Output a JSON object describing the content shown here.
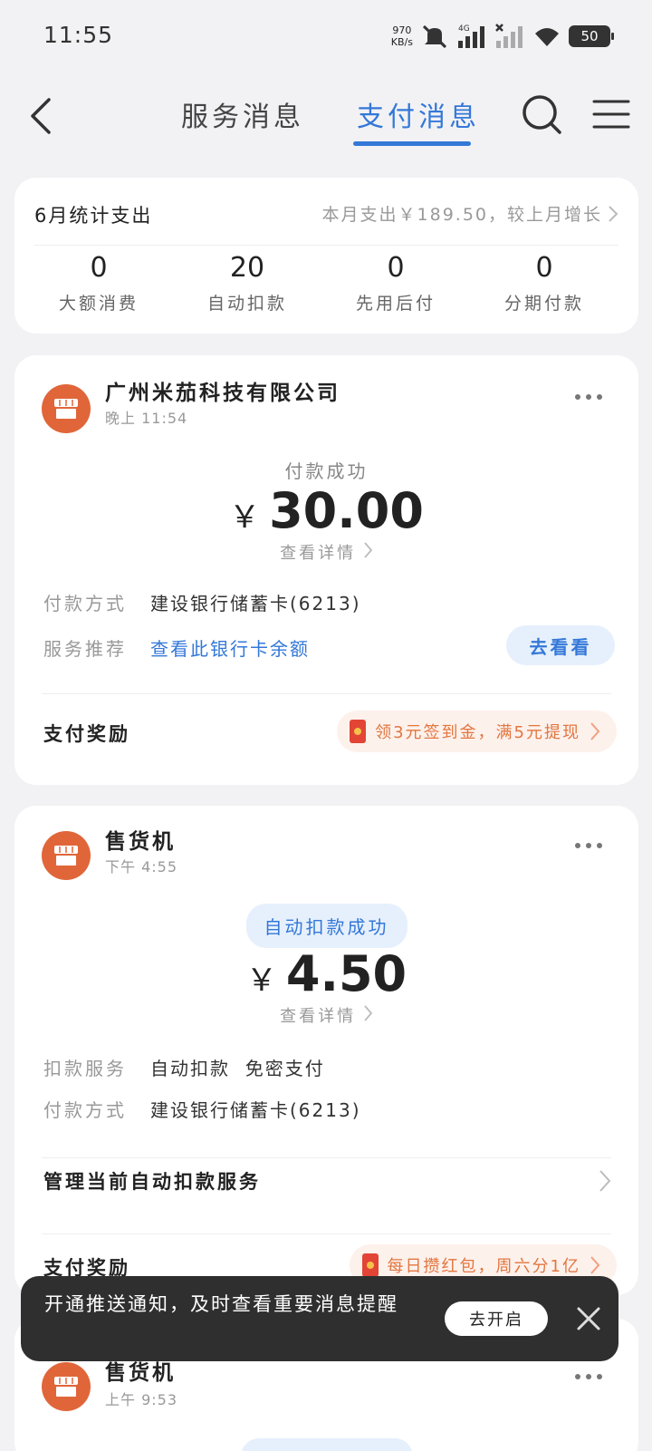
{
  "status_bar": {
    "time": "11:55",
    "net_speed_value": "970",
    "net_speed_unit": "KB/s",
    "network_label": "4G",
    "battery": "50"
  },
  "nav": {
    "tab_service": "服务消息",
    "tab_pay": "支付消息"
  },
  "stats": {
    "title": "6月统计支出",
    "summary": "本月支出￥189.50，较上月增长",
    "items": [
      {
        "value": "0",
        "label": "大额消费"
      },
      {
        "value": "20",
        "label": "自动扣款"
      },
      {
        "value": "0",
        "label": "先用后付"
      },
      {
        "value": "0",
        "label": "分期付款"
      }
    ]
  },
  "payments": [
    {
      "merchant": "广州米茄科技有限公司",
      "time": "晚上 11:54",
      "status": "付款成功",
      "currency": "￥",
      "amount": "30.00",
      "detail": "查看详情",
      "method_label": "付款方式",
      "method_value": "建设银行储蓄卡(6213)",
      "service_label": "服务推荐",
      "service_value": "查看此银行卡余额",
      "service_button": "去看看",
      "reward_label": "支付奖励",
      "reward_text": "领3元签到金，满5元提现"
    },
    {
      "merchant": "售货机",
      "time": "下午 4:55",
      "status": "自动扣款成功",
      "currency": "￥",
      "amount": "4.50",
      "detail": "查看详情",
      "deduct_label": "扣款服务",
      "deduct_value": "自动扣款  免密支付",
      "method_label": "付款方式",
      "method_value": "建设银行储蓄卡(6213)",
      "manage_label": "管理当前自动扣款服务",
      "reward_label": "支付奖励",
      "reward_text": "每日攒红包，周六分1亿"
    },
    {
      "merchant": "售货机",
      "time": "上午 9:53"
    }
  ],
  "toast": {
    "text": "开通推送通知，及时查看重要消息提醒",
    "button": "去开启"
  },
  "colors": {
    "accent": "#3478d8",
    "merchant_icon": "#e0663a",
    "reward_text": "#e2763f",
    "background": "#f2f2f4"
  }
}
